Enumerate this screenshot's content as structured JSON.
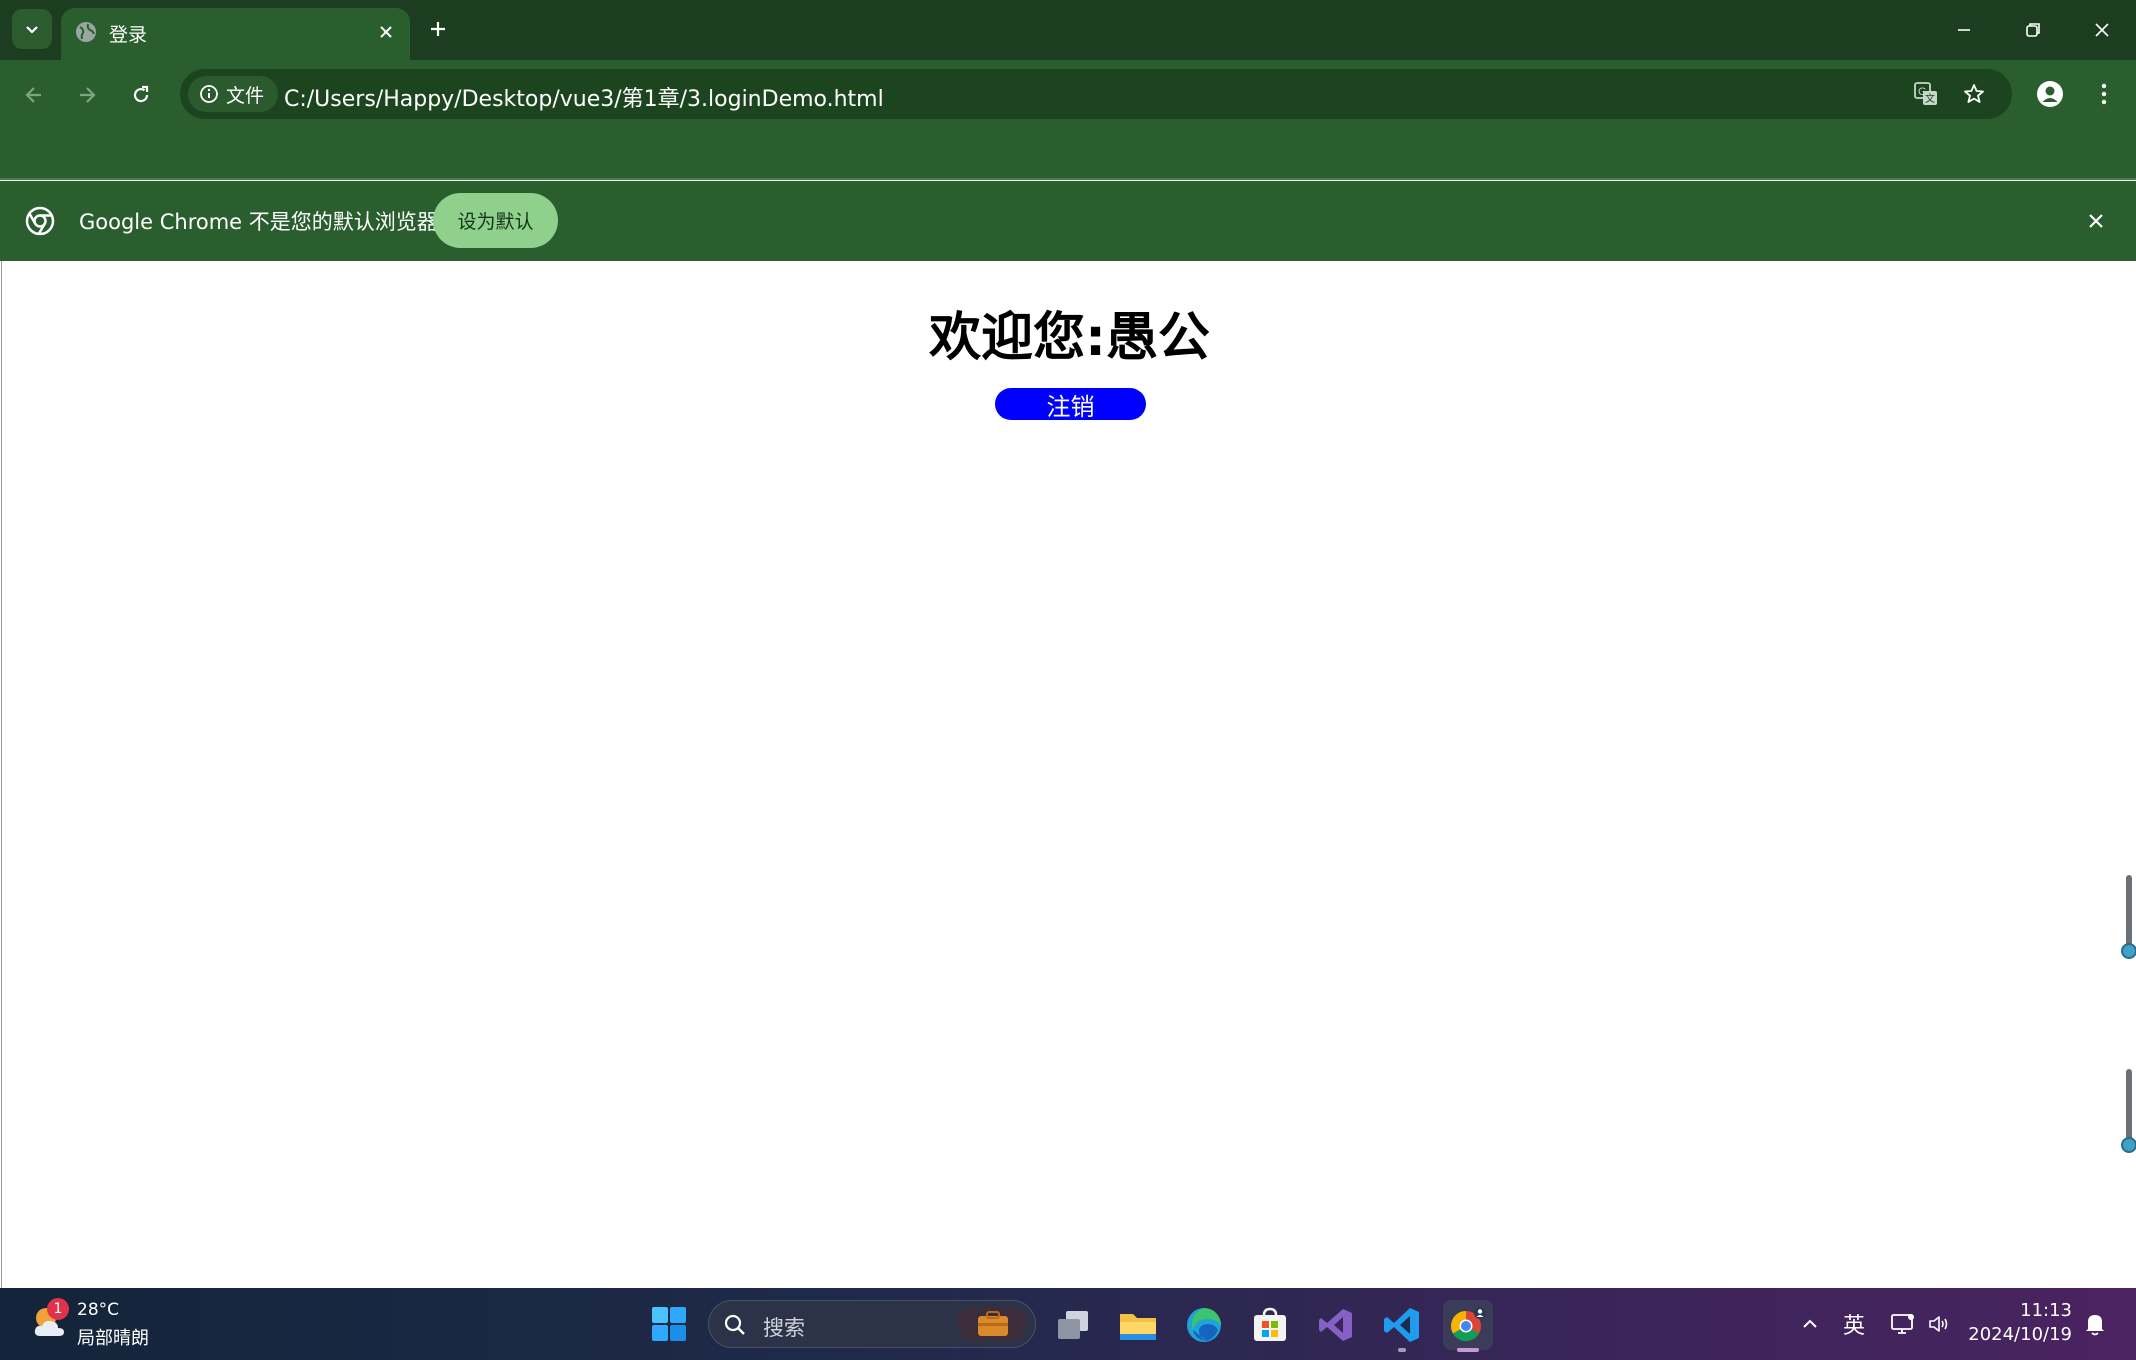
{
  "browser": {
    "tab": {
      "title": "登录",
      "favicon": "globe-icon"
    },
    "window_controls": [
      "minimize-icon",
      "restore-icon",
      "close-icon"
    ]
  },
  "toolbar": {
    "security_chip_label": "文件",
    "url": "C:/Users/Happy/Desktop/vue3/第1章/3.loginDemo.html"
  },
  "infobar": {
    "message": "Google Chrome 不是您的默认浏览器",
    "button_label": "设为默认"
  },
  "page": {
    "welcome_text": "欢迎您:愚公",
    "logout_label": "注销",
    "logout_color": "#0000ff"
  },
  "taskbar": {
    "weather": {
      "temp": "28°C",
      "condition": "局部晴朗",
      "badge": "1"
    },
    "search_placeholder": "搜索",
    "apps": [
      "start-icon",
      "task-view-icon",
      "file-explorer-icon",
      "edge-icon",
      "store-icon",
      "visual-studio-icon",
      "vscode-icon",
      "chrome-icon"
    ],
    "ime": "英",
    "clock": {
      "time": "11:13",
      "date": "2024/10/19"
    }
  },
  "colors": {
    "chrome_frame": "#2a5e2e",
    "tabstrip": "#1c3d1f",
    "button_green": "#8fd18c"
  }
}
